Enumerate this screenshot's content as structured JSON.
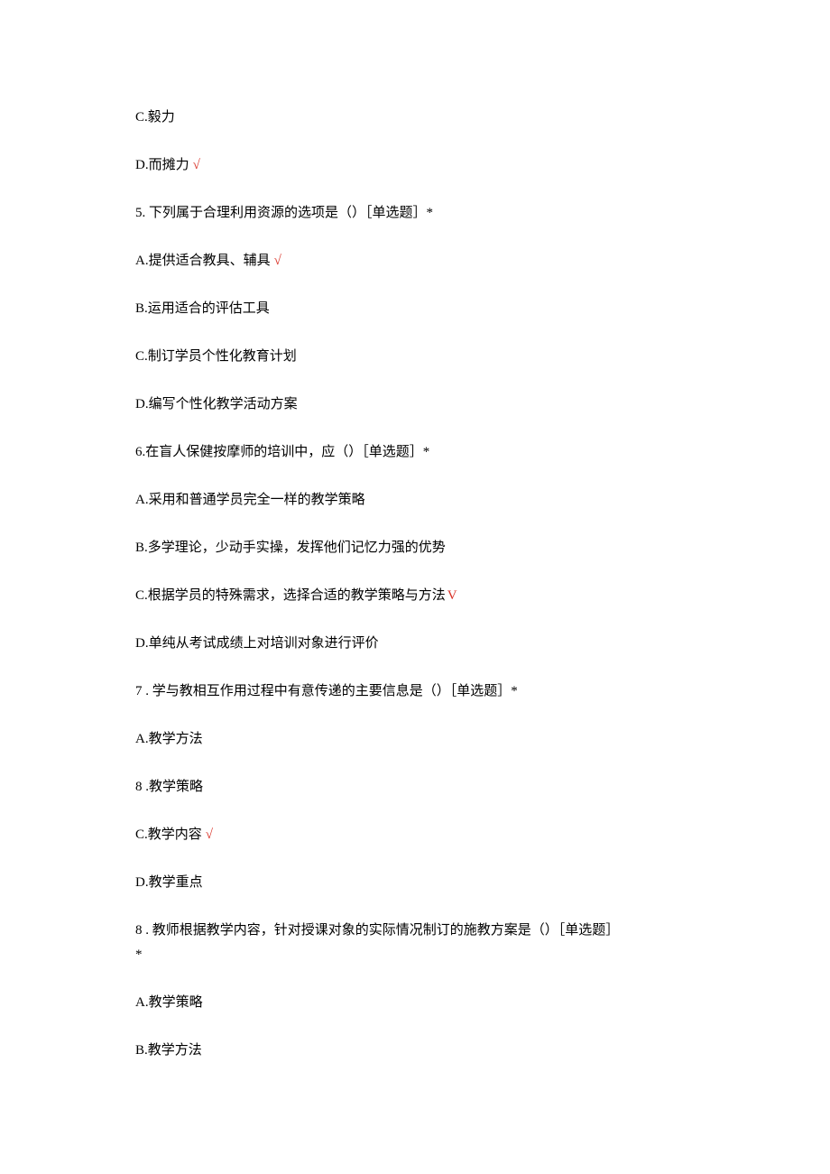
{
  "lines": {
    "q4_c": "C.毅力",
    "q4_d_text": "D.而摊力",
    "q4_d_mark": "√",
    "q5_stem": "5. 下列属于合理利用资源的选项是（）［单选题］*",
    "q5_a_text": "A.提供适合教具、辅具",
    "q5_a_mark": "√",
    "q5_b": "B.运用适合的评估工具",
    "q5_c": "C.制订学员个性化教育计划",
    "q5_d": "D.编写个性化教学活动方案",
    "q6_stem": "6.在盲人保健按摩师的培训中，应（）［单选题］*",
    "q6_a": "A.采用和普通学员完全一样的教学策略",
    "q6_b": "B.多学理论，少动手实操，发挥他们记忆力强的优势",
    "q6_c_text": "C.根据学员的特殊需求，选择合适的教学策略与方法",
    "q6_c_mark": "V",
    "q6_d": "D.单纯从考试成绩上对培训对象进行评价",
    "q7_stem": "7    . 学与教相互作用过程中有意传递的主要信息是（）［单选题］*",
    "q7_a": "A.教学方法",
    "q7_b": "8    .教学策略",
    "q7_c_text": "C.教学内容",
    "q7_c_mark": "√",
    "q7_d": "D.教学重点",
    "q8_stem_line1": "8    . 教师根据教学内容，针对授课对象的实际情况制订的施教方案是（）［单选题］",
    "q8_stem_line2": "*",
    "q8_a": "A.教学策略",
    "q8_b": "B.教学方法"
  }
}
